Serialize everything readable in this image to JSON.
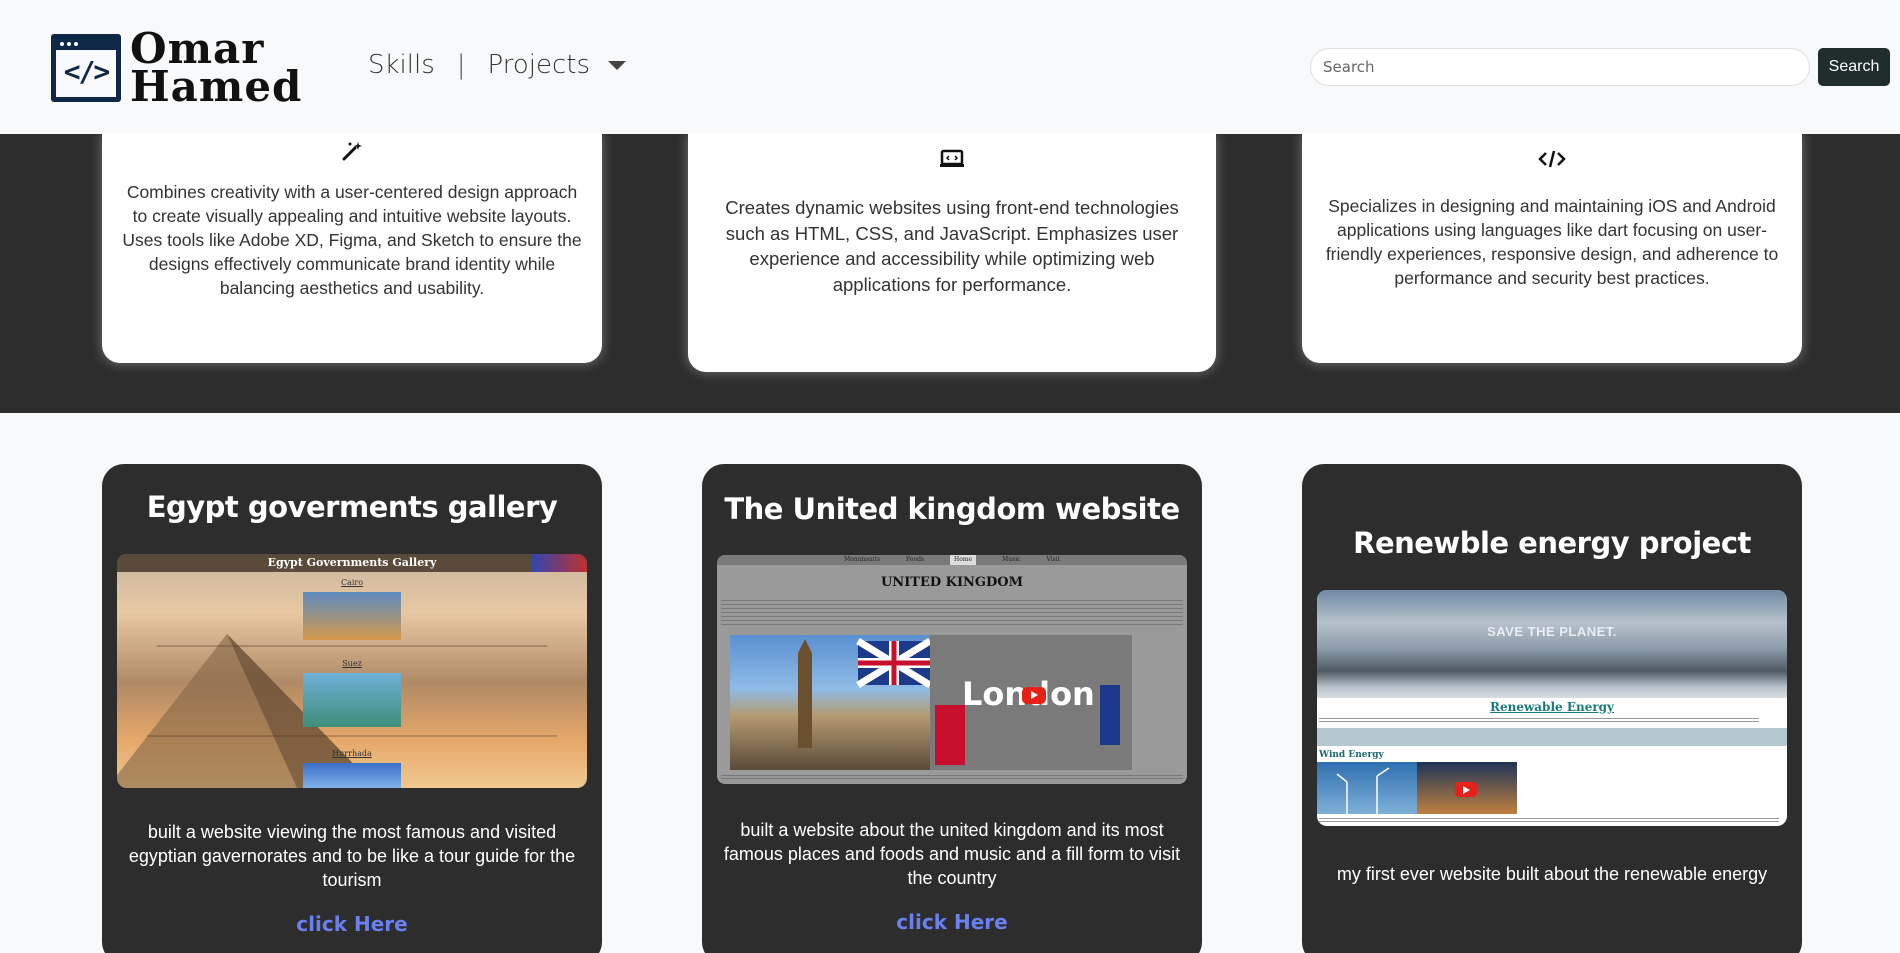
{
  "navbar": {
    "logo_line1": "Omar",
    "logo_line2": "Hamed",
    "logo_code": "</>",
    "skills": "Skills",
    "separator": "|",
    "projects": "Projects",
    "search_placeholder": "Search",
    "search_button": "Search"
  },
  "skills": [
    {
      "icon": "magic-wand-icon",
      "glyph": "✨",
      "text": "Combines creativity with a user-centered design approach to create visually appealing and intuitive website layouts. Uses tools like Adobe XD, Figma, and Sketch to ensure the designs effectively communicate brand identity while balancing aesthetics and usability."
    },
    {
      "icon": "laptop-code-icon",
      "glyph": "⌨",
      "text": "Creates dynamic websites using front-end technologies such as HTML, CSS, and JavaScript. Emphasizes user experience and accessibility while optimizing web applications for performance."
    },
    {
      "icon": "code-icon",
      "glyph": "</>",
      "text": "Specializes in designing and maintaining iOS and Android applications using languages like dart focusing on user-friendly experiences, responsive design, and adherence to performance and security best practices."
    }
  ],
  "projects": [
    {
      "title": "Egypt goverments gallery",
      "description": "built a website viewing the most famous and visited egyptian gavernorates and to be like a tour guide for the tourism",
      "link": "click Here",
      "preview_heading": "Egypt Governments Gallery",
      "preview_items": [
        "Cairo",
        "Suez",
        "Hurrhada"
      ]
    },
    {
      "title": "The United kingdom website",
      "description": "built a website about the united kingdom and its most famous places and foods and music and a fill form to visit the country",
      "link": "click Here",
      "preview_heading": "UNITED KINGDOM",
      "preview_nav": [
        "Monuments",
        "Foods",
        "Home",
        "Music",
        "Visit"
      ],
      "preview_video_text": "London"
    },
    {
      "title": "Renewble energy project",
      "description": "my first ever website built about the renewable energy",
      "link": "",
      "preview_banner": "SAVE THE PLANET.",
      "preview_heading": "Renewable Energy",
      "preview_sub": "Wind Energy"
    }
  ],
  "colors": {
    "dark_bg": "#2d2d2e",
    "link": "#6a7ff0",
    "navy": "#0f2847"
  }
}
